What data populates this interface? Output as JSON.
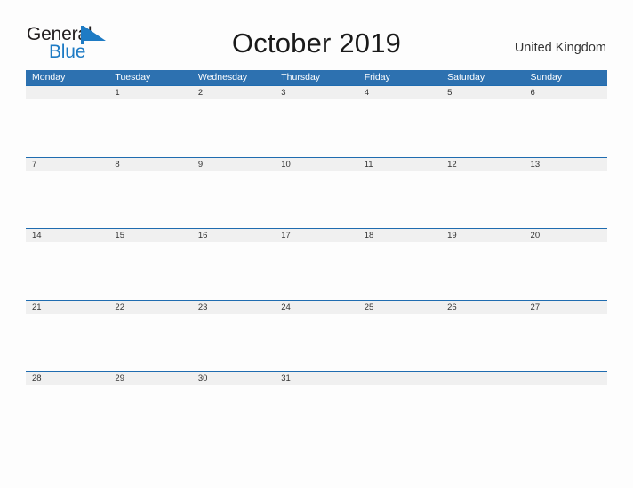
{
  "brand": {
    "name_part1": "General",
    "name_part2": "Blue",
    "flag_icon": "blue-triangle-flag-icon",
    "color_dark": "#231f20",
    "color_blue": "#1e7bc4"
  },
  "header": {
    "title": "October 2019",
    "country": "United Kingdom"
  },
  "calendar": {
    "month": "October",
    "year": "2019",
    "header_color": "#2d71b0",
    "rule_color": "#1f6cb0",
    "band_color": "#f0f0f0",
    "weekdays": [
      "Monday",
      "Tuesday",
      "Wednesday",
      "Thursday",
      "Friday",
      "Saturday",
      "Sunday"
    ],
    "weeks": [
      [
        "",
        "1",
        "2",
        "3",
        "4",
        "5",
        "6"
      ],
      [
        "7",
        "8",
        "9",
        "10",
        "11",
        "12",
        "13"
      ],
      [
        "14",
        "15",
        "16",
        "17",
        "18",
        "19",
        "20"
      ],
      [
        "21",
        "22",
        "23",
        "24",
        "25",
        "26",
        "27"
      ],
      [
        "28",
        "29",
        "30",
        "31",
        "",
        "",
        ""
      ]
    ]
  }
}
